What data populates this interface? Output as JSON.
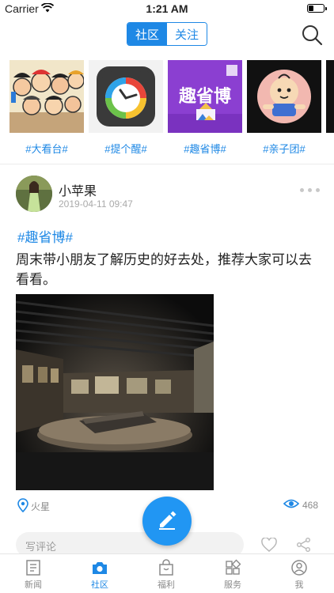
{
  "status": {
    "carrier": "Carrier",
    "time": "1:21 AM"
  },
  "nav": {
    "tabs": [
      "社区",
      "关注"
    ],
    "active_tab": "社区"
  },
  "topics": [
    {
      "label": "#大看台#"
    },
    {
      "label": "#提个醒#"
    },
    {
      "label": "#趣省博#",
      "thumb_text": "趣省博"
    },
    {
      "label": "#亲子团#"
    }
  ],
  "post": {
    "username": "小苹果",
    "time": "2019-04-11 09:47",
    "tag": "#趣省博#",
    "text": "周末带小朋友了解历史的好去处，推荐大家可以去看看。",
    "location": "火星",
    "views": "468"
  },
  "comment": {
    "placeholder": "写评论"
  },
  "tabbar": {
    "items": [
      "新闻",
      "社区",
      "福利",
      "服务",
      "我"
    ],
    "active": "社区"
  },
  "colors": {
    "accent": "#1e88e5",
    "fab": "#2196f3",
    "muted": "#8a8a8a"
  },
  "icons": [
    "wifi-icon",
    "battery-icon",
    "search-icon",
    "location-pin-icon",
    "eye-icon",
    "pencil-icon",
    "heart-icon",
    "share-icon",
    "news-icon",
    "camera-icon",
    "gift-bag-icon",
    "grid-icon",
    "profile-icon"
  ]
}
